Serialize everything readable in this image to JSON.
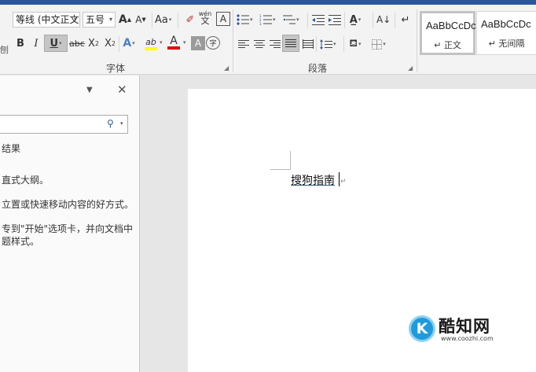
{
  "font_group": {
    "label": "字体",
    "font_name": "等线 (中文正文",
    "font_size": "五号",
    "grow_font": "A",
    "shrink_font": "A",
    "change_case": "Aa",
    "phonetic_top": "wén",
    "phonetic_bottom": "文",
    "char_border": "A",
    "bold": "B",
    "italic": "I",
    "underline": "U",
    "strikethrough": "abc",
    "subscript_base": "X",
    "subscript_mark": "2",
    "superscript_base": "X",
    "superscript_mark": "2",
    "text_effects": "A",
    "highlight": "ab",
    "font_color": "A",
    "char_shading": "A",
    "enclose": "字"
  },
  "paragraph_group": {
    "label": "段落"
  },
  "styles_group": {
    "items": [
      {
        "sample": "AaBbCcDc",
        "name": "正文"
      },
      {
        "sample": "AaBbCcDc",
        "name": "无间隔"
      }
    ]
  },
  "left_edge_label": "刨",
  "nav_pane": {
    "results_tab": "结果",
    "hint_line1": "直式大纲。",
    "hint_line2": "立置或快速移动内容的好方式。",
    "hint_line3": "专到\"开始\"选项卡，并向文档中",
    "hint_line4": "题样式。"
  },
  "document": {
    "text": "搜狗指南"
  },
  "watermark": {
    "logo": "K",
    "title": "酷知网",
    "url": "www.coozhi.com"
  },
  "colors": {
    "ribbon": "#f3f3f3",
    "accent": "#2b579a",
    "highlight_yellow": "#ffff00",
    "font_red": "#e00000",
    "watermark_blue": "#1e9bdc"
  }
}
